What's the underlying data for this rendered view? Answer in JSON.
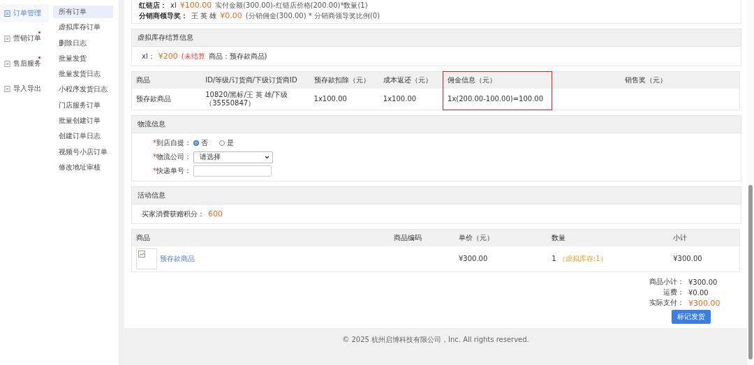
{
  "sidebar": {
    "items": [
      {
        "label": "订单管理",
        "selected": true,
        "badge": false
      },
      {
        "label": "营销订单",
        "selected": false,
        "badge": true
      },
      {
        "label": "售后服务",
        "selected": false,
        "badge": true
      },
      {
        "label": "导入导出",
        "selected": false,
        "badge": false
      }
    ]
  },
  "submenu": {
    "items": [
      {
        "label": "所有订单",
        "selected": true
      },
      {
        "label": "虚拟库存订单",
        "selected": false
      },
      {
        "label": "删除日志",
        "selected": false
      },
      {
        "label": "批量发货",
        "selected": false
      },
      {
        "label": "批量发货日志",
        "selected": false
      },
      {
        "label": "小程序发货日志",
        "selected": false
      },
      {
        "label": "门店服务订单",
        "selected": false
      },
      {
        "label": "批量创建订单",
        "selected": false
      },
      {
        "label": "创建订单日志",
        "selected": false
      },
      {
        "label": "视频号小店订单",
        "selected": false
      },
      {
        "label": "修改地址审核",
        "selected": false
      }
    ]
  },
  "rewards": [
    {
      "label": "红链店：",
      "name": "xl",
      "amount": "¥100.00",
      "note": "实付金额(300.00)-红链店价格(200.00)*数量(1)"
    },
    {
      "label": "分销商领导奖：",
      "name": "王 英 雄",
      "amount": "¥0.00",
      "note": "(分销佣金(300.00) * 分销商领导奖比例(0)"
    }
  ],
  "virtual_settlement": {
    "title": "虚拟库存结算信息",
    "name": "xl：",
    "amount": "¥200",
    "status": "(未结算",
    "product": "商品：预存款商品)"
  },
  "commission_table": {
    "columns": [
      {
        "label": "商品",
        "highlighted": false
      },
      {
        "label": "ID/等级/订货商/下级订货商ID",
        "highlighted": false
      },
      {
        "label": "预存款扣除（元）",
        "highlighted": false
      },
      {
        "label": "成本返还（元）",
        "highlighted": false
      },
      {
        "label": "佣金信息（元）",
        "highlighted": true
      },
      {
        "label": "销售奖（元）",
        "highlighted": false
      }
    ],
    "rows": [
      [
        "预存款商品",
        "10820/黑标/王 英 雄/下级（35550847）",
        "1x100.00",
        "1x100.00",
        "1x(200.00-100.00)=100.00"
      ]
    ]
  },
  "logistics": {
    "title": "物流信息",
    "pickup": {
      "mark": "*",
      "label": "到店自提：",
      "options": [
        {
          "label": "否",
          "selected": true
        },
        {
          "label": "是",
          "selected": false
        }
      ]
    },
    "company": {
      "mark": "*",
      "label": "物流公司：",
      "value": "请选择"
    },
    "tracking": {
      "mark": "*",
      "label": "快递单号："
    }
  },
  "activity": {
    "title": "活动信息",
    "label": "买家消费获赠积分：",
    "points": "600"
  },
  "product_table": {
    "columns": [
      "商品",
      "商品编码",
      "单价（元）",
      "数量",
      "小计"
    ],
    "rows": [
      {
        "name": "预存款商品",
        "price": "¥300.00",
        "quantity": "1",
        "stock_note": "（虚拟库存:1）",
        "subtotal": "¥300.00"
      }
    ]
  },
  "summary": [
    {
      "label": "商品小计：",
      "value": "¥300.00",
      "emphasis": false
    },
    {
      "label": "运费：",
      "value": "¥0.00",
      "emphasis": false
    },
    {
      "label": "实际支付：",
      "value": "¥300.00",
      "emphasis": true
    }
  ],
  "ship_button": "标记发货",
  "footer": "© 2025 杭州启博科技有限公司，Inc. All rights reserved."
}
